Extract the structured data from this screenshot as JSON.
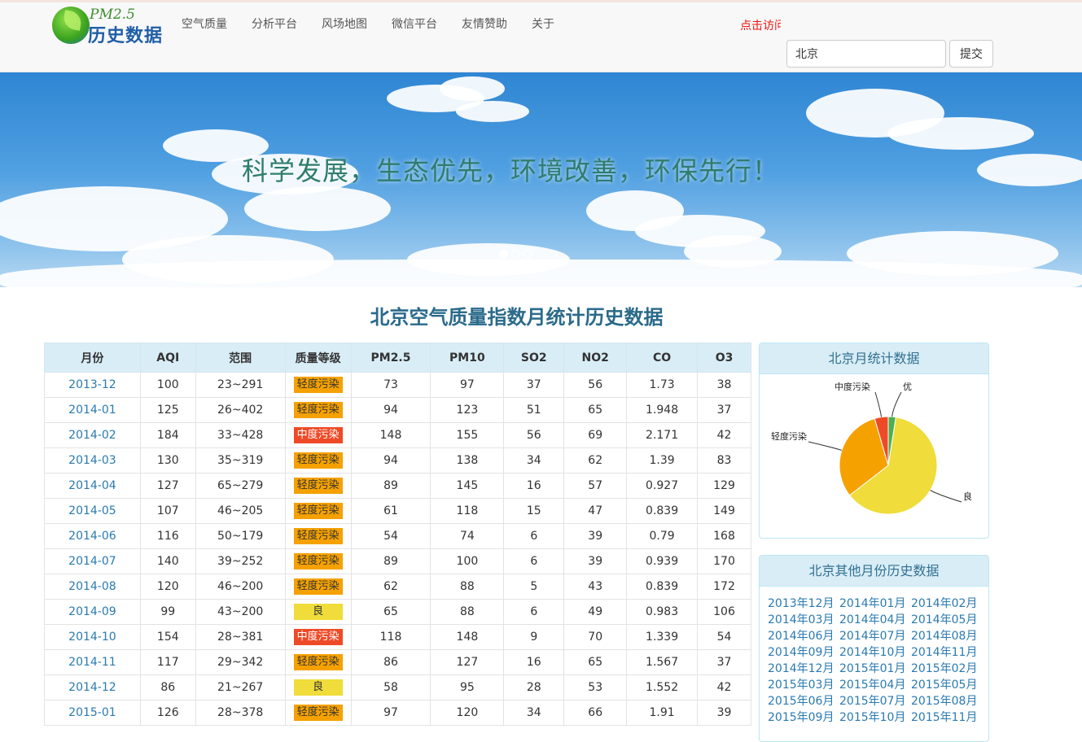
{
  "header": {
    "logo_sub": "PM2.5",
    "logo_main": "历史数据",
    "nav": [
      "空气质量",
      "分析平台",
      "风场地图",
      "微信平台",
      "友情赞助",
      "关于"
    ],
    "visit_link": "点击访问",
    "search_value": "北京",
    "submit_label": "提交"
  },
  "banner": {
    "slogan": "科学发展，生态优先，环境改善，环保先行！",
    "slide_count": 3,
    "active_slide": 0
  },
  "page_title": "北京空气质量指数月统计历史数据",
  "colors": {
    "good": "#f0dc3a",
    "light": "#f5a100",
    "mid": "#ef4a27",
    "excellent": "#4caf50",
    "link": "#2a7ab0"
  },
  "table": {
    "headers": [
      "月份",
      "AQI",
      "范围",
      "质量等级",
      "PM2.5",
      "PM10",
      "SO2",
      "NO2",
      "CO",
      "O3"
    ],
    "rows": [
      [
        "2013-12",
        "100",
        "23~291",
        "轻度污染",
        "73",
        "97",
        "37",
        "56",
        "1.73",
        "38"
      ],
      [
        "2014-01",
        "125",
        "26~402",
        "轻度污染",
        "94",
        "123",
        "51",
        "65",
        "1.948",
        "37"
      ],
      [
        "2014-02",
        "184",
        "33~428",
        "中度污染",
        "148",
        "155",
        "56",
        "69",
        "2.171",
        "42"
      ],
      [
        "2014-03",
        "130",
        "35~319",
        "轻度污染",
        "94",
        "138",
        "34",
        "62",
        "1.39",
        "83"
      ],
      [
        "2014-04",
        "127",
        "65~279",
        "轻度污染",
        "89",
        "145",
        "16",
        "57",
        "0.927",
        "129"
      ],
      [
        "2014-05",
        "107",
        "46~205",
        "轻度污染",
        "61",
        "118",
        "15",
        "47",
        "0.839",
        "149"
      ],
      [
        "2014-06",
        "116",
        "50~179",
        "轻度污染",
        "54",
        "74",
        "6",
        "39",
        "0.79",
        "168"
      ],
      [
        "2014-07",
        "140",
        "39~252",
        "轻度污染",
        "89",
        "100",
        "6",
        "39",
        "0.939",
        "170"
      ],
      [
        "2014-08",
        "120",
        "46~200",
        "轻度污染",
        "62",
        "88",
        "5",
        "43",
        "0.839",
        "172"
      ],
      [
        "2014-09",
        "99",
        "43~200",
        "良",
        "65",
        "88",
        "6",
        "49",
        "0.983",
        "106"
      ],
      [
        "2014-10",
        "154",
        "28~381",
        "中度污染",
        "118",
        "148",
        "9",
        "70",
        "1.339",
        "54"
      ],
      [
        "2014-11",
        "117",
        "29~342",
        "轻度污染",
        "86",
        "127",
        "16",
        "65",
        "1.567",
        "37"
      ],
      [
        "2014-12",
        "86",
        "21~267",
        "良",
        "58",
        "95",
        "28",
        "53",
        "1.552",
        "42"
      ],
      [
        "2015-01",
        "126",
        "28~378",
        "轻度污染",
        "97",
        "120",
        "34",
        "66",
        "1.91",
        "39"
      ]
    ]
  },
  "stats_panel": {
    "title": "北京月统计数据"
  },
  "chart_data": {
    "type": "pie",
    "categories": [
      "良",
      "轻度污染",
      "中度污染",
      "优"
    ],
    "values": [
      62,
      31,
      4.5,
      2.5
    ],
    "colors": [
      "#f0dc3a",
      "#f5a100",
      "#ef4a27",
      "#4caf50"
    ]
  },
  "history_panel": {
    "title": "北京其他月份历史数据",
    "links": [
      "2013年12月",
      "2014年01月",
      "2014年02月",
      "2014年03月",
      "2014年04月",
      "2014年05月",
      "2014年06月",
      "2014年07月",
      "2014年08月",
      "2014年09月",
      "2014年10月",
      "2014年11月",
      "2014年12月",
      "2015年01月",
      "2015年02月",
      "2015年03月",
      "2015年04月",
      "2015年05月",
      "2015年06月",
      "2015年07月",
      "2015年08月",
      "2015年09月",
      "2015年10月",
      "2015年11月"
    ]
  }
}
